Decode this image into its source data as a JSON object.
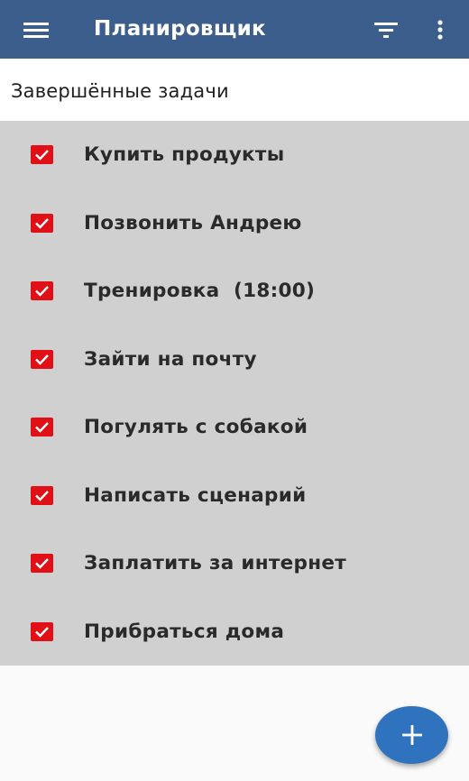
{
  "appbar": {
    "title": "Планировщик",
    "background": "#3c5e8d",
    "icons": {
      "menu": "menu-icon",
      "filter": "filter-icon",
      "more": "more-vert-icon"
    }
  },
  "section": {
    "title": "Завершённые задачи"
  },
  "tasks": [
    {
      "label": "Купить продукты",
      "checked": true
    },
    {
      "label": "Позвонить Андрею",
      "checked": true
    },
    {
      "label": "Тренировка  (18:00)",
      "checked": true
    },
    {
      "label": "Зайти на почту",
      "checked": true
    },
    {
      "label": "Погулять с собакой",
      "checked": true
    },
    {
      "label": "Написать сценарий",
      "checked": true
    },
    {
      "label": "Заплатить за интернет",
      "checked": true
    },
    {
      "label": "Прибраться дома",
      "checked": true
    }
  ],
  "colors": {
    "checkbox": "#e11017",
    "list_background": "#d0d0d0",
    "fab": "#2f73be"
  },
  "fab": {
    "icon": "plus-icon"
  }
}
